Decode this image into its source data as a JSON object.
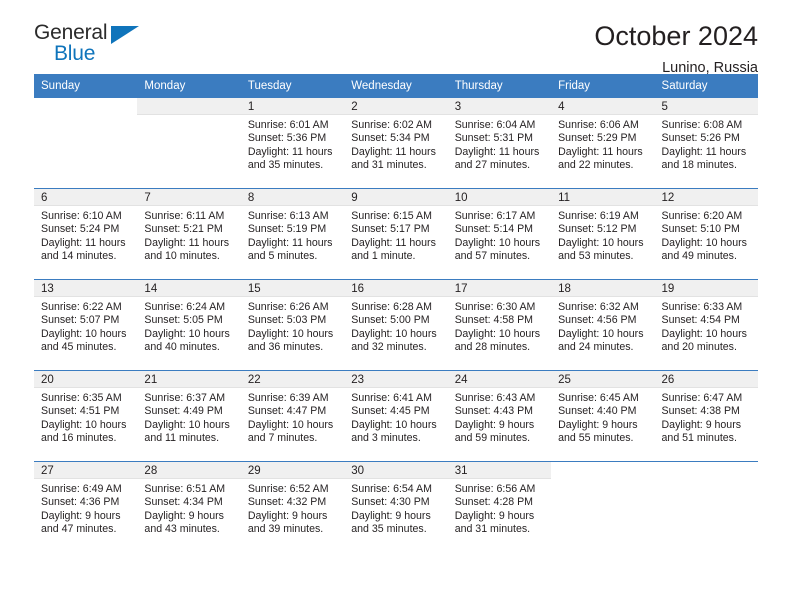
{
  "brand": {
    "name_top": "General",
    "name_bottom": "Blue",
    "triangle_color": "#0f74bb"
  },
  "header": {
    "title": "October 2024",
    "subtitle": "Lunino, Russia"
  },
  "colors": {
    "header_blue": "#3b7cc0",
    "daynum_band": "#f0f0f0",
    "text": "#231f20"
  },
  "labels": {
    "sunrise_prefix": "Sunrise:",
    "sunset_prefix": "Sunset:",
    "daylight_prefix": "Daylight:"
  },
  "weekday_headers": [
    "Sunday",
    "Monday",
    "Tuesday",
    "Wednesday",
    "Thursday",
    "Friday",
    "Saturday"
  ],
  "weeks": [
    [
      {
        "day": "",
        "sunrise": "",
        "sunset": "",
        "daylight": "",
        "blank": true
      },
      {
        "day": "",
        "sunrise": "",
        "sunset": "",
        "daylight": "",
        "blank": false
      },
      {
        "day": "1",
        "sunrise": "Sunrise: 6:01 AM",
        "sunset": "Sunset: 5:36 PM",
        "daylight": "Daylight: 11 hours and 35 minutes."
      },
      {
        "day": "2",
        "sunrise": "Sunrise: 6:02 AM",
        "sunset": "Sunset: 5:34 PM",
        "daylight": "Daylight: 11 hours and 31 minutes."
      },
      {
        "day": "3",
        "sunrise": "Sunrise: 6:04 AM",
        "sunset": "Sunset: 5:31 PM",
        "daylight": "Daylight: 11 hours and 27 minutes."
      },
      {
        "day": "4",
        "sunrise": "Sunrise: 6:06 AM",
        "sunset": "Sunset: 5:29 PM",
        "daylight": "Daylight: 11 hours and 22 minutes."
      },
      {
        "day": "5",
        "sunrise": "Sunrise: 6:08 AM",
        "sunset": "Sunset: 5:26 PM",
        "daylight": "Daylight: 11 hours and 18 minutes."
      }
    ],
    [
      {
        "day": "6",
        "sunrise": "Sunrise: 6:10 AM",
        "sunset": "Sunset: 5:24 PM",
        "daylight": "Daylight: 11 hours and 14 minutes."
      },
      {
        "day": "7",
        "sunrise": "Sunrise: 6:11 AM",
        "sunset": "Sunset: 5:21 PM",
        "daylight": "Daylight: 11 hours and 10 minutes."
      },
      {
        "day": "8",
        "sunrise": "Sunrise: 6:13 AM",
        "sunset": "Sunset: 5:19 PM",
        "daylight": "Daylight: 11 hours and 5 minutes."
      },
      {
        "day": "9",
        "sunrise": "Sunrise: 6:15 AM",
        "sunset": "Sunset: 5:17 PM",
        "daylight": "Daylight: 11 hours and 1 minute."
      },
      {
        "day": "10",
        "sunrise": "Sunrise: 6:17 AM",
        "sunset": "Sunset: 5:14 PM",
        "daylight": "Daylight: 10 hours and 57 minutes."
      },
      {
        "day": "11",
        "sunrise": "Sunrise: 6:19 AM",
        "sunset": "Sunset: 5:12 PM",
        "daylight": "Daylight: 10 hours and 53 minutes."
      },
      {
        "day": "12",
        "sunrise": "Sunrise: 6:20 AM",
        "sunset": "Sunset: 5:10 PM",
        "daylight": "Daylight: 10 hours and 49 minutes."
      }
    ],
    [
      {
        "day": "13",
        "sunrise": "Sunrise: 6:22 AM",
        "sunset": "Sunset: 5:07 PM",
        "daylight": "Daylight: 10 hours and 45 minutes."
      },
      {
        "day": "14",
        "sunrise": "Sunrise: 6:24 AM",
        "sunset": "Sunset: 5:05 PM",
        "daylight": "Daylight: 10 hours and 40 minutes."
      },
      {
        "day": "15",
        "sunrise": "Sunrise: 6:26 AM",
        "sunset": "Sunset: 5:03 PM",
        "daylight": "Daylight: 10 hours and 36 minutes."
      },
      {
        "day": "16",
        "sunrise": "Sunrise: 6:28 AM",
        "sunset": "Sunset: 5:00 PM",
        "daylight": "Daylight: 10 hours and 32 minutes."
      },
      {
        "day": "17",
        "sunrise": "Sunrise: 6:30 AM",
        "sunset": "Sunset: 4:58 PM",
        "daylight": "Daylight: 10 hours and 28 minutes."
      },
      {
        "day": "18",
        "sunrise": "Sunrise: 6:32 AM",
        "sunset": "Sunset: 4:56 PM",
        "daylight": "Daylight: 10 hours and 24 minutes."
      },
      {
        "day": "19",
        "sunrise": "Sunrise: 6:33 AM",
        "sunset": "Sunset: 4:54 PM",
        "daylight": "Daylight: 10 hours and 20 minutes."
      }
    ],
    [
      {
        "day": "20",
        "sunrise": "Sunrise: 6:35 AM",
        "sunset": "Sunset: 4:51 PM",
        "daylight": "Daylight: 10 hours and 16 minutes."
      },
      {
        "day": "21",
        "sunrise": "Sunrise: 6:37 AM",
        "sunset": "Sunset: 4:49 PM",
        "daylight": "Daylight: 10 hours and 11 minutes."
      },
      {
        "day": "22",
        "sunrise": "Sunrise: 6:39 AM",
        "sunset": "Sunset: 4:47 PM",
        "daylight": "Daylight: 10 hours and 7 minutes."
      },
      {
        "day": "23",
        "sunrise": "Sunrise: 6:41 AM",
        "sunset": "Sunset: 4:45 PM",
        "daylight": "Daylight: 10 hours and 3 minutes."
      },
      {
        "day": "24",
        "sunrise": "Sunrise: 6:43 AM",
        "sunset": "Sunset: 4:43 PM",
        "daylight": "Daylight: 9 hours and 59 minutes."
      },
      {
        "day": "25",
        "sunrise": "Sunrise: 6:45 AM",
        "sunset": "Sunset: 4:40 PM",
        "daylight": "Daylight: 9 hours and 55 minutes."
      },
      {
        "day": "26",
        "sunrise": "Sunrise: 6:47 AM",
        "sunset": "Sunset: 4:38 PM",
        "daylight": "Daylight: 9 hours and 51 minutes."
      }
    ],
    [
      {
        "day": "27",
        "sunrise": "Sunrise: 6:49 AM",
        "sunset": "Sunset: 4:36 PM",
        "daylight": "Daylight: 9 hours and 47 minutes."
      },
      {
        "day": "28",
        "sunrise": "Sunrise: 6:51 AM",
        "sunset": "Sunset: 4:34 PM",
        "daylight": "Daylight: 9 hours and 43 minutes."
      },
      {
        "day": "29",
        "sunrise": "Sunrise: 6:52 AM",
        "sunset": "Sunset: 4:32 PM",
        "daylight": "Daylight: 9 hours and 39 minutes."
      },
      {
        "day": "30",
        "sunrise": "Sunrise: 6:54 AM",
        "sunset": "Sunset: 4:30 PM",
        "daylight": "Daylight: 9 hours and 35 minutes."
      },
      {
        "day": "31",
        "sunrise": "Sunrise: 6:56 AM",
        "sunset": "Sunset: 4:28 PM",
        "daylight": "Daylight: 9 hours and 31 minutes."
      },
      {
        "day": "",
        "sunrise": "",
        "sunset": "",
        "daylight": "",
        "blank": true
      },
      {
        "day": "",
        "sunrise": "",
        "sunset": "",
        "daylight": "",
        "blank": true
      }
    ]
  ]
}
